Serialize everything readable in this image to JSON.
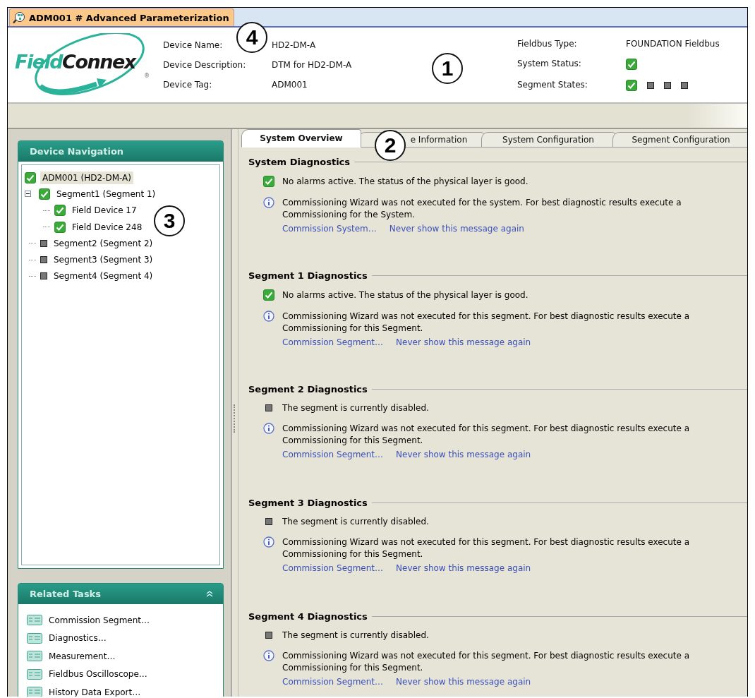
{
  "window": {
    "title": "ADM001 # Advanced Parameterization"
  },
  "logo": {
    "text_1": "Field",
    "text_2": "Connex",
    "mark": "®"
  },
  "device_info": [
    {
      "label": "Device Name:",
      "value": "HD2-DM-A"
    },
    {
      "label": "Device Description:",
      "value": "DTM for HD2-DM-A"
    },
    {
      "label": "Device Tag:",
      "value": "ADM001"
    }
  ],
  "bus_info": {
    "fieldbus_type_label": "Fieldbus Type:",
    "fieldbus_type": "FOUNDATION Fieldbus",
    "system_status_label": "System Status:",
    "system_status": {
      "disabled": false
    },
    "segment_states_label": "Segment States:",
    "segment_states": [
      {
        "disabled": false
      },
      {
        "disabled": true
      },
      {
        "disabled": true
      },
      {
        "disabled": true
      }
    ]
  },
  "navigation": {
    "title": "Device Navigation",
    "tree": [
      {
        "label": "ADM001 (HD2-DM-A)",
        "disabled": false,
        "selected": true,
        "children": [
          {
            "label": "Segment1 (Segment 1)",
            "disabled": false,
            "selected": false,
            "expanded": true,
            "children": [
              {
                "label": "Field Device 17",
                "disabled": false,
                "selected": false
              },
              {
                "label": "Field Device 248",
                "disabled": false,
                "selected": false
              }
            ]
          },
          {
            "label": "Segment2 (Segment 2)",
            "disabled": true,
            "selected": false
          },
          {
            "label": "Segment3 (Segment 3)",
            "disabled": true,
            "selected": false
          },
          {
            "label": "Segment4 (Segment 4)",
            "disabled": true,
            "selected": false
          }
        ]
      }
    ]
  },
  "related_tasks": {
    "title": "Related Tasks",
    "expanded": true,
    "items": [
      "Commission Segment…",
      "Diagnostics…",
      "Measurement…",
      "Fieldbus Oscilloscope…",
      "History Data Export…"
    ]
  },
  "tabs": [
    {
      "label": "System Overview",
      "selected": true
    },
    {
      "label": "e Information",
      "selected": false
    },
    {
      "label": "System Configuration",
      "selected": false
    },
    {
      "label": "Segment Configuration",
      "selected": false
    }
  ],
  "sections": [
    {
      "title": "System Diagnostics",
      "disabled": false,
      "status_text": "No alarms active. The status of the physical layer is good.",
      "info": "Commissioning Wizard was not executed for the system. For best diagnostic results execute a Commissioning for the System.",
      "links": [
        "Commission System…",
        "Never show this message again"
      ]
    },
    {
      "title": "Segment 1 Diagnostics",
      "disabled": false,
      "status_text": "No alarms active. The status of the physical layer is good.",
      "info": "Commissioning Wizard was not executed for this segment. For best diagnostic results execute a Commissioning for this Segment.",
      "links": [
        "Commission Segment…",
        "Never show this message again"
      ]
    },
    {
      "title": "Segment 2 Diagnostics",
      "disabled": true,
      "status_text": "The segment is currently disabled.",
      "info": "Commissioning Wizard was not executed for this segment. For best diagnostic results execute a Commissioning for this Segment.",
      "links": [
        "Commission Segment…",
        "Never show this message again"
      ]
    },
    {
      "title": "Segment 3 Diagnostics",
      "disabled": true,
      "status_text": "The segment is currently disabled.",
      "info": "Commissioning Wizard was not executed for this segment. For best diagnostic results execute a Commissioning for this Segment.",
      "links": [
        "Commission Segment…",
        "Never show this message again"
      ]
    },
    {
      "title": "Segment 4 Diagnostics",
      "disabled": true,
      "status_text": "The segment is currently disabled.",
      "info": "Commissioning Wizard was not executed for this segment. For best diagnostic results execute a Commissioning for this Segment.",
      "links": [
        "Commission Segment…",
        "Never show this message again"
      ]
    }
  ],
  "callouts": [
    "1",
    "2",
    "3",
    "4"
  ]
}
